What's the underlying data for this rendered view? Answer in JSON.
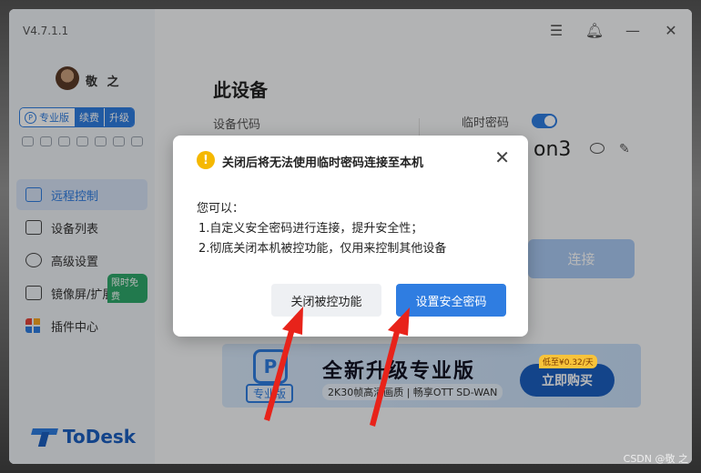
{
  "app": {
    "version": "V4.7.1.1",
    "username": "敬 之",
    "logo_text": "ToDesk"
  },
  "plan": {
    "pro_label": "专业版",
    "pro_icon_letter": "P",
    "renew_label": "续费",
    "upgrade_label": "升级"
  },
  "sidebar": {
    "items": [
      {
        "label": "远程控制",
        "icon": "remote-control-icon",
        "active": true
      },
      {
        "label": "设备列表",
        "icon": "device-list-icon"
      },
      {
        "label": "高级设置",
        "icon": "settings-icon"
      },
      {
        "label": "镜像屏/扩展屏",
        "icon": "mirror-screen-icon",
        "badge": "限时免费"
      },
      {
        "label": "插件中心",
        "icon": "plugin-icon"
      }
    ]
  },
  "main": {
    "title": "此设备",
    "device_code_label": "设备代码",
    "temp_password_label": "临时密码",
    "password_partial": "on3",
    "connect_label": "连接"
  },
  "banner": {
    "pro_tag": "专业版",
    "hex_letter": "P",
    "title": "全新升级专业版",
    "subtitle": "2K30帧高清画质  |  畅享OTT SD-WAN",
    "price": "低至¥0.32/天",
    "buy_label": "立即购买"
  },
  "dialog": {
    "title": "关闭后将无法使用临时密码连接至本机",
    "intro": "您可以：",
    "items": [
      "1.自定义安全密码进行连接，提升安全性；",
      "2.彻底关闭本机被控功能，仅用来控制其他设备"
    ],
    "disable_label": "关闭被控功能",
    "set_password_label": "设置安全密码",
    "close_glyph": "✕",
    "warn_glyph": "!"
  },
  "watermark": "CSDN @敬 之",
  "colors": {
    "accent": "#2f7de1",
    "warning": "#f5b800",
    "arrow": "#e8231a"
  }
}
